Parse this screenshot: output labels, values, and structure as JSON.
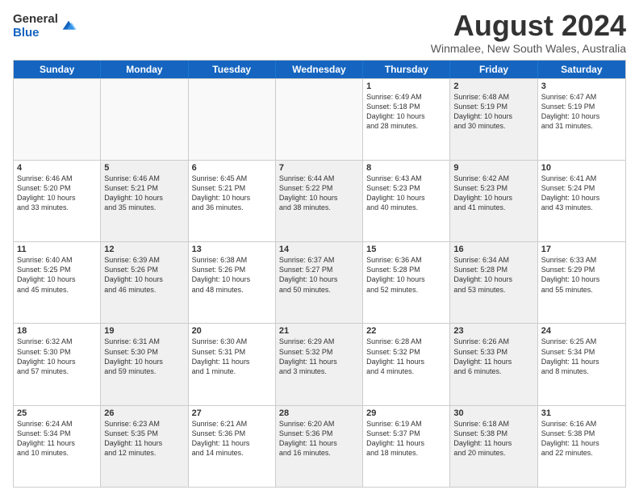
{
  "header": {
    "logo_general": "General",
    "logo_blue": "Blue",
    "main_title": "August 2024",
    "subtitle": "Winmalee, New South Wales, Australia"
  },
  "weekdays": [
    "Sunday",
    "Monday",
    "Tuesday",
    "Wednesday",
    "Thursday",
    "Friday",
    "Saturday"
  ],
  "rows": [
    [
      {
        "day": "",
        "text": "",
        "shaded": false,
        "empty": true
      },
      {
        "day": "",
        "text": "",
        "shaded": false,
        "empty": true
      },
      {
        "day": "",
        "text": "",
        "shaded": false,
        "empty": true
      },
      {
        "day": "",
        "text": "",
        "shaded": false,
        "empty": true
      },
      {
        "day": "1",
        "text": "Sunrise: 6:49 AM\nSunset: 5:18 PM\nDaylight: 10 hours\nand 28 minutes.",
        "shaded": false,
        "empty": false
      },
      {
        "day": "2",
        "text": "Sunrise: 6:48 AM\nSunset: 5:19 PM\nDaylight: 10 hours\nand 30 minutes.",
        "shaded": true,
        "empty": false
      },
      {
        "day": "3",
        "text": "Sunrise: 6:47 AM\nSunset: 5:19 PM\nDaylight: 10 hours\nand 31 minutes.",
        "shaded": false,
        "empty": false
      }
    ],
    [
      {
        "day": "4",
        "text": "Sunrise: 6:46 AM\nSunset: 5:20 PM\nDaylight: 10 hours\nand 33 minutes.",
        "shaded": false,
        "empty": false
      },
      {
        "day": "5",
        "text": "Sunrise: 6:46 AM\nSunset: 5:21 PM\nDaylight: 10 hours\nand 35 minutes.",
        "shaded": true,
        "empty": false
      },
      {
        "day": "6",
        "text": "Sunrise: 6:45 AM\nSunset: 5:21 PM\nDaylight: 10 hours\nand 36 minutes.",
        "shaded": false,
        "empty": false
      },
      {
        "day": "7",
        "text": "Sunrise: 6:44 AM\nSunset: 5:22 PM\nDaylight: 10 hours\nand 38 minutes.",
        "shaded": true,
        "empty": false
      },
      {
        "day": "8",
        "text": "Sunrise: 6:43 AM\nSunset: 5:23 PM\nDaylight: 10 hours\nand 40 minutes.",
        "shaded": false,
        "empty": false
      },
      {
        "day": "9",
        "text": "Sunrise: 6:42 AM\nSunset: 5:23 PM\nDaylight: 10 hours\nand 41 minutes.",
        "shaded": true,
        "empty": false
      },
      {
        "day": "10",
        "text": "Sunrise: 6:41 AM\nSunset: 5:24 PM\nDaylight: 10 hours\nand 43 minutes.",
        "shaded": false,
        "empty": false
      }
    ],
    [
      {
        "day": "11",
        "text": "Sunrise: 6:40 AM\nSunset: 5:25 PM\nDaylight: 10 hours\nand 45 minutes.",
        "shaded": false,
        "empty": false
      },
      {
        "day": "12",
        "text": "Sunrise: 6:39 AM\nSunset: 5:26 PM\nDaylight: 10 hours\nand 46 minutes.",
        "shaded": true,
        "empty": false
      },
      {
        "day": "13",
        "text": "Sunrise: 6:38 AM\nSunset: 5:26 PM\nDaylight: 10 hours\nand 48 minutes.",
        "shaded": false,
        "empty": false
      },
      {
        "day": "14",
        "text": "Sunrise: 6:37 AM\nSunset: 5:27 PM\nDaylight: 10 hours\nand 50 minutes.",
        "shaded": true,
        "empty": false
      },
      {
        "day": "15",
        "text": "Sunrise: 6:36 AM\nSunset: 5:28 PM\nDaylight: 10 hours\nand 52 minutes.",
        "shaded": false,
        "empty": false
      },
      {
        "day": "16",
        "text": "Sunrise: 6:34 AM\nSunset: 5:28 PM\nDaylight: 10 hours\nand 53 minutes.",
        "shaded": true,
        "empty": false
      },
      {
        "day": "17",
        "text": "Sunrise: 6:33 AM\nSunset: 5:29 PM\nDaylight: 10 hours\nand 55 minutes.",
        "shaded": false,
        "empty": false
      }
    ],
    [
      {
        "day": "18",
        "text": "Sunrise: 6:32 AM\nSunset: 5:30 PM\nDaylight: 10 hours\nand 57 minutes.",
        "shaded": false,
        "empty": false
      },
      {
        "day": "19",
        "text": "Sunrise: 6:31 AM\nSunset: 5:30 PM\nDaylight: 10 hours\nand 59 minutes.",
        "shaded": true,
        "empty": false
      },
      {
        "day": "20",
        "text": "Sunrise: 6:30 AM\nSunset: 5:31 PM\nDaylight: 11 hours\nand 1 minute.",
        "shaded": false,
        "empty": false
      },
      {
        "day": "21",
        "text": "Sunrise: 6:29 AM\nSunset: 5:32 PM\nDaylight: 11 hours\nand 3 minutes.",
        "shaded": true,
        "empty": false
      },
      {
        "day": "22",
        "text": "Sunrise: 6:28 AM\nSunset: 5:32 PM\nDaylight: 11 hours\nand 4 minutes.",
        "shaded": false,
        "empty": false
      },
      {
        "day": "23",
        "text": "Sunrise: 6:26 AM\nSunset: 5:33 PM\nDaylight: 11 hours\nand 6 minutes.",
        "shaded": true,
        "empty": false
      },
      {
        "day": "24",
        "text": "Sunrise: 6:25 AM\nSunset: 5:34 PM\nDaylight: 11 hours\nand 8 minutes.",
        "shaded": false,
        "empty": false
      }
    ],
    [
      {
        "day": "25",
        "text": "Sunrise: 6:24 AM\nSunset: 5:34 PM\nDaylight: 11 hours\nand 10 minutes.",
        "shaded": false,
        "empty": false
      },
      {
        "day": "26",
        "text": "Sunrise: 6:23 AM\nSunset: 5:35 PM\nDaylight: 11 hours\nand 12 minutes.",
        "shaded": true,
        "empty": false
      },
      {
        "day": "27",
        "text": "Sunrise: 6:21 AM\nSunset: 5:36 PM\nDaylight: 11 hours\nand 14 minutes.",
        "shaded": false,
        "empty": false
      },
      {
        "day": "28",
        "text": "Sunrise: 6:20 AM\nSunset: 5:36 PM\nDaylight: 11 hours\nand 16 minutes.",
        "shaded": true,
        "empty": false
      },
      {
        "day": "29",
        "text": "Sunrise: 6:19 AM\nSunset: 5:37 PM\nDaylight: 11 hours\nand 18 minutes.",
        "shaded": false,
        "empty": false
      },
      {
        "day": "30",
        "text": "Sunrise: 6:18 AM\nSunset: 5:38 PM\nDaylight: 11 hours\nand 20 minutes.",
        "shaded": true,
        "empty": false
      },
      {
        "day": "31",
        "text": "Sunrise: 6:16 AM\nSunset: 5:38 PM\nDaylight: 11 hours\nand 22 minutes.",
        "shaded": false,
        "empty": false
      }
    ]
  ]
}
